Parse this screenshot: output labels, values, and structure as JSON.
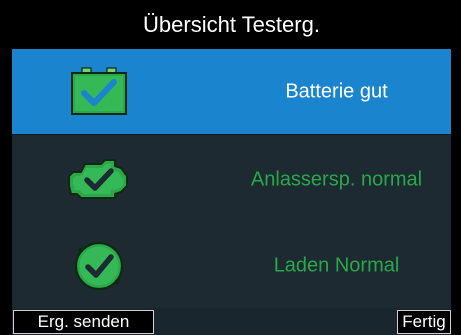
{
  "title": "Übersicht Testerg.",
  "rows": [
    {
      "label": "Batterie gut",
      "icon": "battery-check-icon",
      "color": "#ffffff"
    },
    {
      "label": "Anlassersp. normal",
      "icon": "starter-motor-check-icon",
      "color": "#27a84a"
    },
    {
      "label": "Laden Normal",
      "icon": "alternator-check-icon",
      "color": "#27a84a"
    }
  ],
  "footer": {
    "send_label": "Erg. senden",
    "done_label": "Fertig"
  },
  "colors": {
    "selected_row": "#1a84cf",
    "row_background": "#1d2a31",
    "status_green": "#27a84a"
  }
}
